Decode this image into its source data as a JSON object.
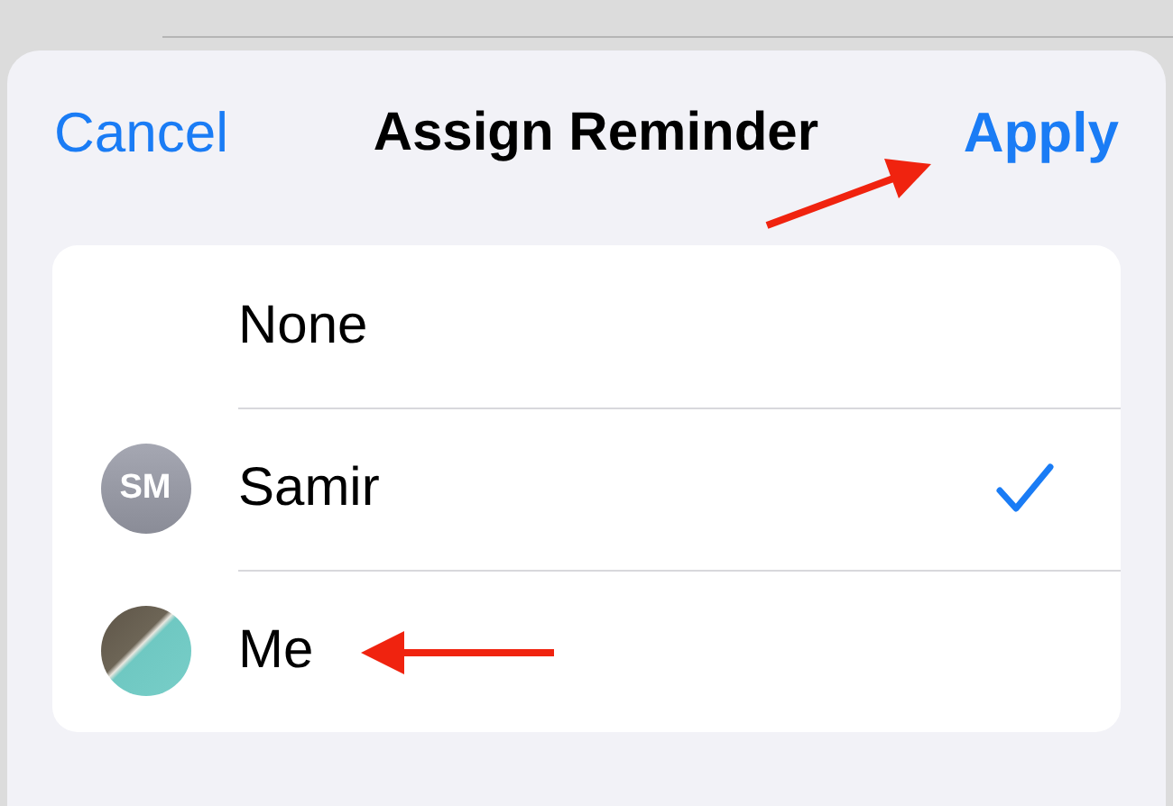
{
  "header": {
    "cancel": "Cancel",
    "title": "Assign Reminder",
    "apply": "Apply"
  },
  "options": [
    {
      "kind": "none",
      "name": "None",
      "selected": false
    },
    {
      "kind": "initials",
      "initials": "SM",
      "name": "Samir",
      "selected": true
    },
    {
      "kind": "photo",
      "name": "Me",
      "selected": false
    }
  ]
}
